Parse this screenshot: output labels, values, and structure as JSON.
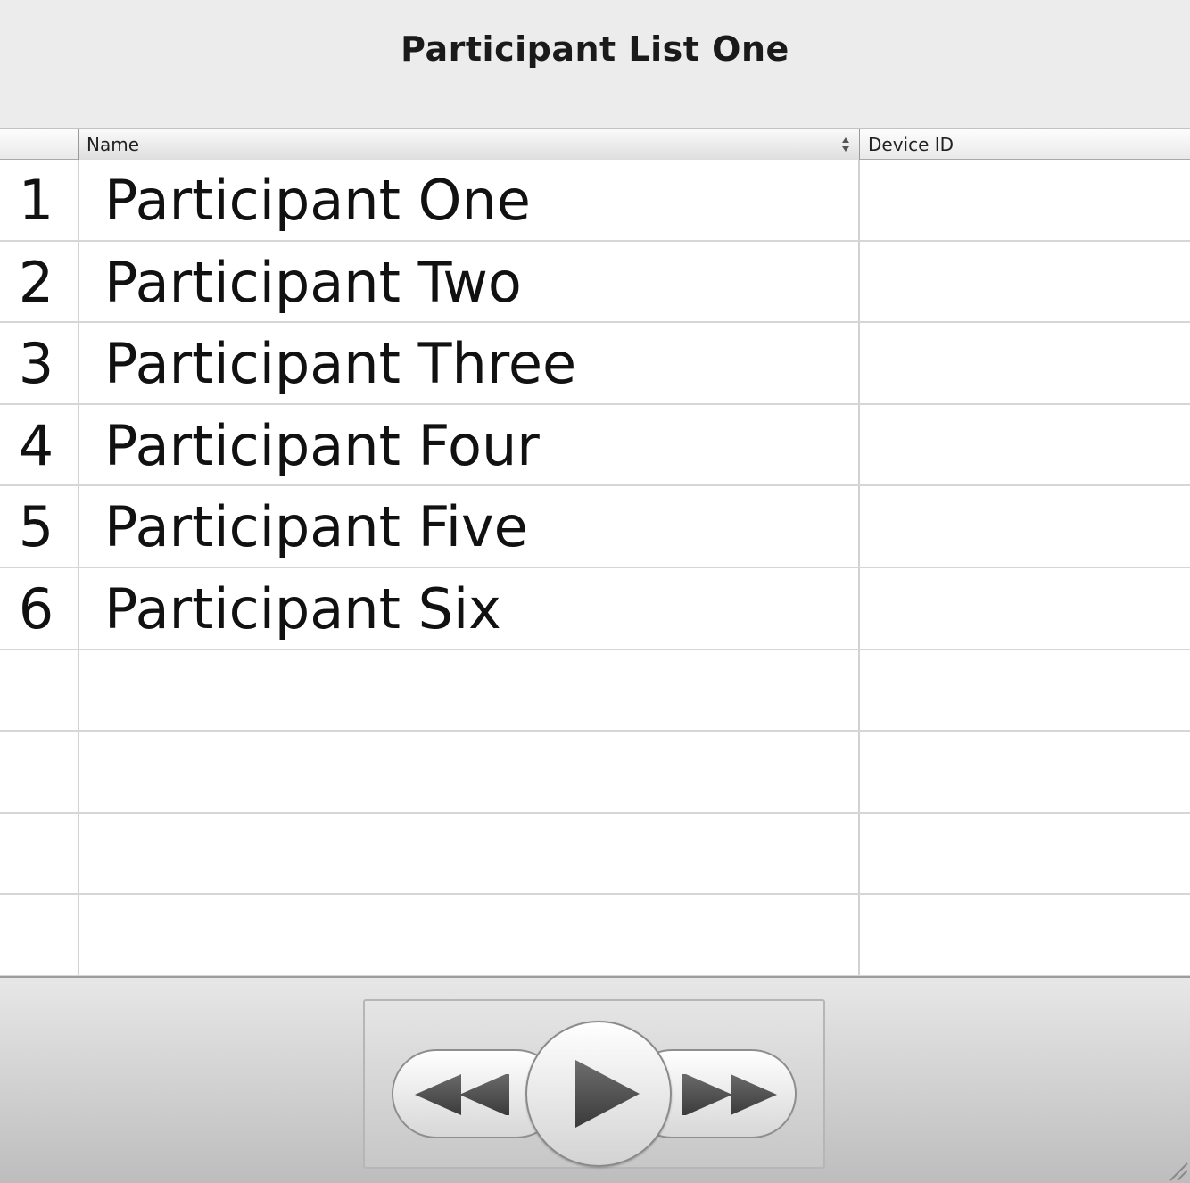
{
  "window": {
    "title": "Participant List One"
  },
  "table": {
    "columns": {
      "number": "",
      "name": "Name",
      "device_id": "Device ID"
    },
    "rows": [
      {
        "number": "1",
        "name": "Participant One",
        "device_id": ""
      },
      {
        "number": "2",
        "name": "Participant Two",
        "device_id": ""
      },
      {
        "number": "3",
        "name": "Participant Three",
        "device_id": ""
      },
      {
        "number": "4",
        "name": "Participant Four",
        "device_id": ""
      },
      {
        "number": "5",
        "name": "Participant Five",
        "device_id": ""
      },
      {
        "number": "6",
        "name": "Participant Six",
        "device_id": ""
      },
      {
        "number": "",
        "name": "",
        "device_id": ""
      },
      {
        "number": "",
        "name": "",
        "device_id": ""
      },
      {
        "number": "",
        "name": "",
        "device_id": ""
      },
      {
        "number": "",
        "name": "",
        "device_id": ""
      }
    ]
  },
  "transport": {
    "icons": [
      "rewind-icon",
      "play-icon",
      "fast-forward-icon"
    ]
  },
  "colors": {
    "window_bg": "#ececec",
    "grid_line": "#d6d6d6",
    "text": "#111111"
  }
}
